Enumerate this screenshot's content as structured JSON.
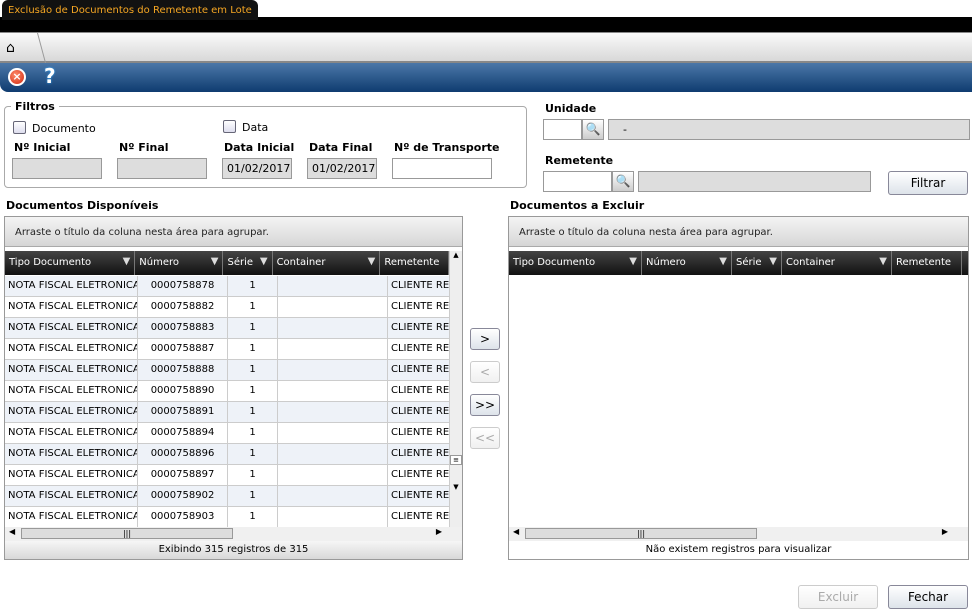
{
  "window": {
    "title": "Exclusão de Documentos do Remetente em Lote"
  },
  "toolbar": {
    "close_icon": "close-icon",
    "help_icon": "help-icon",
    "home_icon": "home-icon"
  },
  "filters": {
    "legend": "Filtros",
    "documento_label": "Documento",
    "data_label": "Data",
    "n_inicial_label": "Nº Inicial",
    "n_final_label": "Nº Final",
    "data_inicial_label": "Data Inicial",
    "data_final_label": "Data Final",
    "n_transporte_label": "Nº de Transporte",
    "n_inicial": "",
    "n_final": "",
    "data_inicial": "01/02/2017",
    "data_final": "01/02/2017",
    "n_transporte": ""
  },
  "unidade": {
    "label": "Unidade",
    "code": "",
    "name": "-"
  },
  "remetente": {
    "label": "Remetente",
    "code": "",
    "name": ""
  },
  "filtrar_label": "Filtrar",
  "left": {
    "title": "Documentos Disponíveis",
    "group_hint": "Arraste o título da coluna nesta área para agrupar.",
    "columns": [
      "Tipo Documento",
      "Número",
      "Série",
      "Container",
      "Remetente"
    ],
    "rows": [
      [
        "NOTA FISCAL ELETRONICA",
        "0000758878",
        "1",
        "",
        "CLIENTE RE"
      ],
      [
        "NOTA FISCAL ELETRONICA",
        "0000758882",
        "1",
        "",
        "CLIENTE RE"
      ],
      [
        "NOTA FISCAL ELETRONICA",
        "0000758883",
        "1",
        "",
        "CLIENTE RE"
      ],
      [
        "NOTA FISCAL ELETRONICA",
        "0000758887",
        "1",
        "",
        "CLIENTE RE"
      ],
      [
        "NOTA FISCAL ELETRONICA",
        "0000758888",
        "1",
        "",
        "CLIENTE RE"
      ],
      [
        "NOTA FISCAL ELETRONICA",
        "0000758890",
        "1",
        "",
        "CLIENTE RE"
      ],
      [
        "NOTA FISCAL ELETRONICA",
        "0000758891",
        "1",
        "",
        "CLIENTE RE"
      ],
      [
        "NOTA FISCAL ELETRONICA",
        "0000758894",
        "1",
        "",
        "CLIENTE RE"
      ],
      [
        "NOTA FISCAL ELETRONICA",
        "0000758896",
        "1",
        "",
        "CLIENTE RE"
      ],
      [
        "NOTA FISCAL ELETRONICA",
        "0000758897",
        "1",
        "",
        "CLIENTE RE"
      ],
      [
        "NOTA FISCAL ELETRONICA",
        "0000758902",
        "1",
        "",
        "CLIENTE RE"
      ],
      [
        "NOTA FISCAL ELETRONICA",
        "0000758903",
        "1",
        "",
        "CLIENTE RE"
      ]
    ],
    "footer": "Exibindo 315 registros de 315"
  },
  "right": {
    "title": "Documentos a Excluir",
    "group_hint": "Arraste o título da coluna nesta área para agrupar.",
    "columns": [
      "Tipo Documento",
      "Número",
      "Série",
      "Container",
      "Remetente"
    ],
    "footer": "Não existem registros para visualizar"
  },
  "transfer": {
    "add": ">",
    "remove": "<",
    "add_all": ">>",
    "remove_all": "<<"
  },
  "actions": {
    "excluir": "Excluir",
    "fechar": "Fechar"
  }
}
